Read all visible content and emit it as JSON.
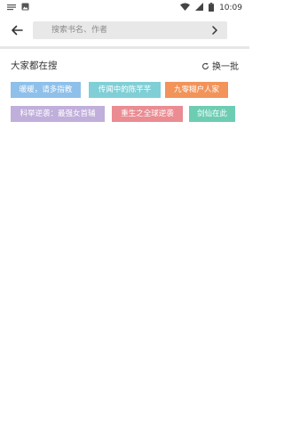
{
  "status_bar": {
    "time": "10:09",
    "icons": [
      "notification-icon",
      "image-icon",
      "wifi-icon",
      "signal-icon",
      "battery-icon"
    ]
  },
  "search": {
    "placeholder": "搜索书名、作者",
    "value": ""
  },
  "hot": {
    "title": "大家都在搜",
    "refresh_label": "换一批",
    "tags": [
      {
        "label": "暖暖，请多指教",
        "color": "#8ec0ea"
      },
      {
        "label": "传闻中的陈芊芊",
        "color": "#80cfd6"
      },
      {
        "label": "九零糊户人家",
        "color": "#f2935a"
      },
      {
        "label": "科举逆袭：最强女首辅",
        "color": "#c0aedb"
      },
      {
        "label": "重生之全球逆袭",
        "color": "#ea8c92"
      },
      {
        "label": "剑仙在此",
        "color": "#6dcdb3"
      }
    ]
  }
}
